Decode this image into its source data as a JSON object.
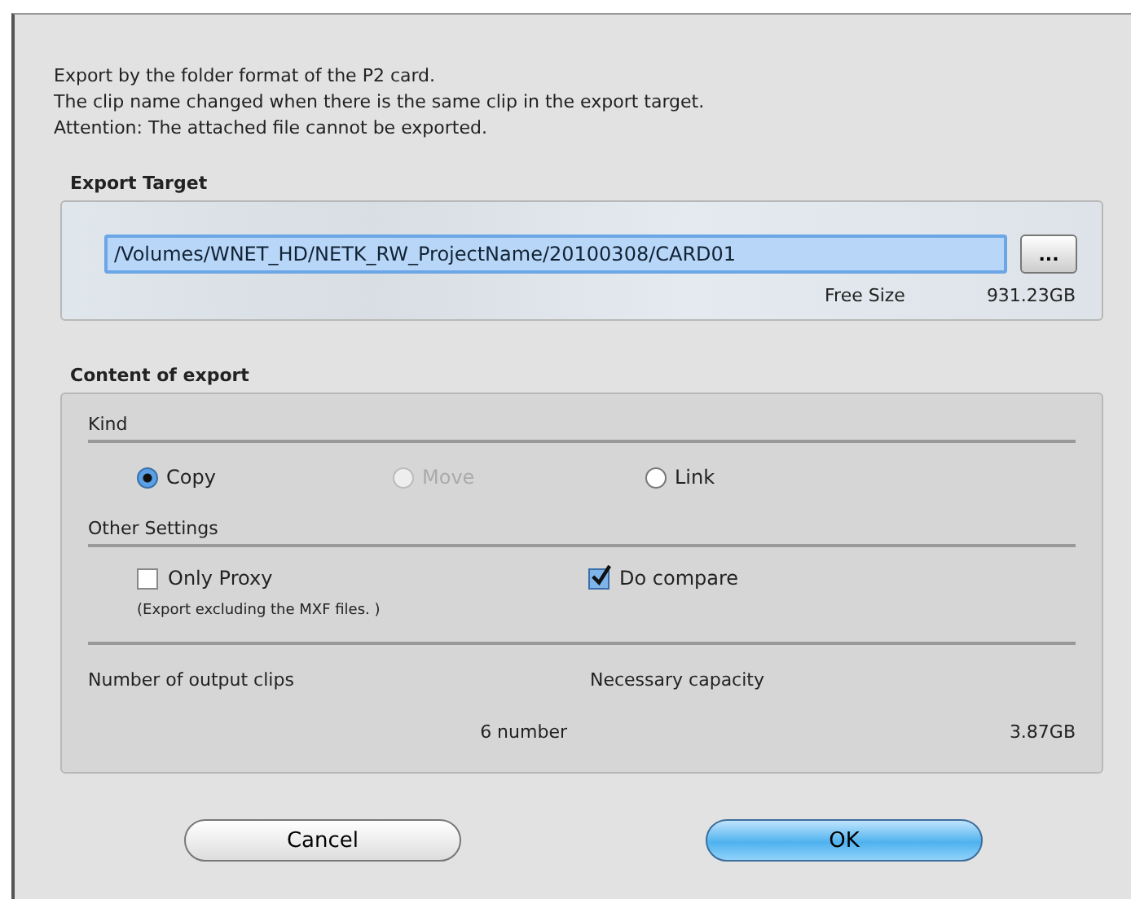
{
  "intro": [
    "Export by the folder format of the P2 card.",
    "The clip name changed when there is the same clip in the export target.",
    "Attention: The attached file cannot be exported."
  ],
  "export_target": {
    "title": "Export Target",
    "path": "/Volumes/WNET_HD/NETK_RW_ProjectName/20100308/CARD01",
    "browse": "...",
    "free_size_label": "Free Size",
    "free_size": "931.23GB"
  },
  "content": {
    "title": "Content of export",
    "kind": {
      "title": "Kind",
      "options": [
        {
          "label": "Copy",
          "selected": true,
          "disabled": false
        },
        {
          "label": "Move",
          "selected": false,
          "disabled": true
        },
        {
          "label": "Link",
          "selected": false,
          "disabled": false
        }
      ]
    },
    "other": {
      "title": "Other Settings",
      "options": [
        {
          "label": "Only Proxy",
          "checked": false,
          "note": "(Export excluding the MXF files. )"
        },
        {
          "label": "Do compare",
          "checked": true
        }
      ]
    },
    "clips_label": "Number of output clips",
    "clips_value": "6  number",
    "capacity_label": "Necessary capacity",
    "capacity_value": "3.87GB"
  },
  "buttons": [
    {
      "label": "Cancel",
      "default": false
    },
    {
      "label": "OK",
      "default": true
    }
  ]
}
